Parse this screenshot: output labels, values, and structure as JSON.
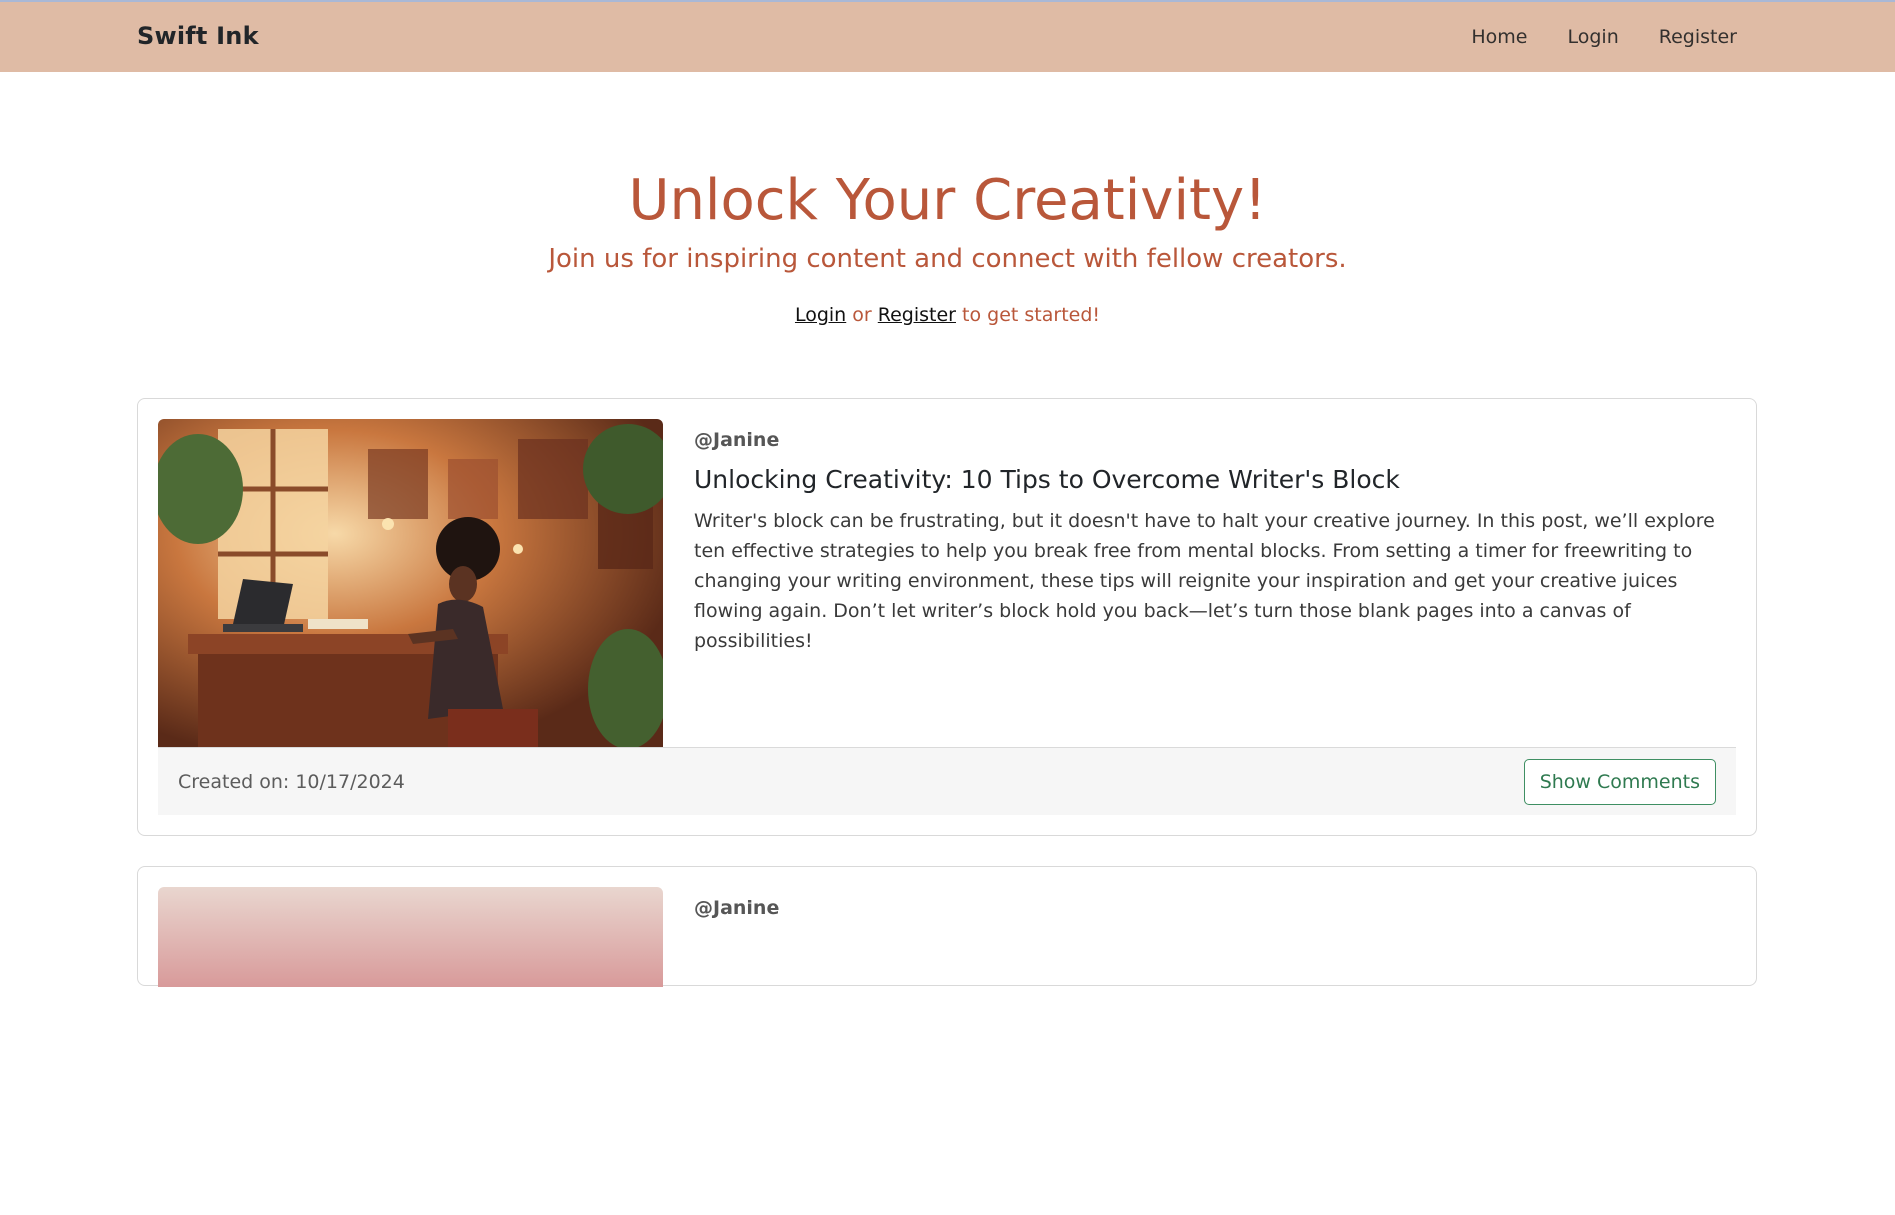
{
  "navbar": {
    "brand": "Swift Ink",
    "links": [
      "Home",
      "Login",
      "Register"
    ],
    "background": "#dfbba5"
  },
  "hero": {
    "title": "Unlock Your Creativity!",
    "subtitle": "Join us for inspiring content and connect with fellow creators.",
    "cta_login": "Login",
    "cta_or": "or",
    "cta_register": "Register",
    "cta_tail": "to get started!",
    "accent": "#b9573a"
  },
  "posts": [
    {
      "author": "@Janine",
      "title": "Unlocking Creativity: 10 Tips to Overcome Writer's Block",
      "excerpt": "Writer's block can be frustrating, but it doesn't have to halt your creative journey. In this post, we’ll explore ten effective strategies to help you break free from mental blocks. From setting a timer for freewriting to changing your writing environment, these tips will reignite your inspiration and get your creative juices flowing again. Don’t let writer’s block hold you back—let’s turn those blank pages into a canvas of possibilities!",
      "created": "Created on: 10/17/2024",
      "comments_button": "Show Comments"
    },
    {
      "author": "@Janine"
    }
  ]
}
